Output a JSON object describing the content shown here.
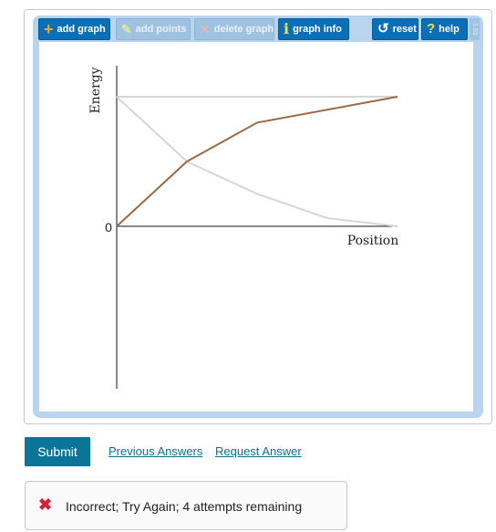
{
  "toolbar": {
    "add_graph": "add graph",
    "add_points": "add points",
    "delete_graph": "delete graph",
    "graph_info": "graph info",
    "reset": "reset",
    "help": "help",
    "side_tab": "1.63"
  },
  "colors": {
    "accent": "#0b6fb6",
    "submit": "#0a7596",
    "student_curve": "#9b6a43",
    "reference_curve": "#d6d6d6",
    "error": "#d4213b"
  },
  "chart_data": {
    "type": "line",
    "ylabel": "Energy",
    "xlabel": "Position",
    "y_tick_labels": [
      "0"
    ],
    "xlim": [
      0,
      10
    ],
    "ylim": [
      -6,
      6
    ],
    "series": [
      {
        "color": "#d6d6d6",
        "x": [
          0,
          10
        ],
        "y": [
          4,
          4
        ]
      },
      {
        "color": "#d6d6d6",
        "x": [
          0,
          2.5,
          5,
          7.5,
          10
        ],
        "y": [
          4,
          2,
          1,
          0.25,
          0
        ]
      },
      {
        "color": "#9b6a43",
        "x": [
          0,
          2.5,
          5,
          10
        ],
        "y": [
          0,
          2,
          3.2,
          4
        ]
      }
    ]
  },
  "actions": {
    "submit": "Submit",
    "previous_answers": "Previous Answers",
    "request_answer": "Request Answer"
  },
  "feedback": {
    "icon": "x-mark-icon",
    "message": "Incorrect; Try Again; 4 attempts remaining"
  }
}
